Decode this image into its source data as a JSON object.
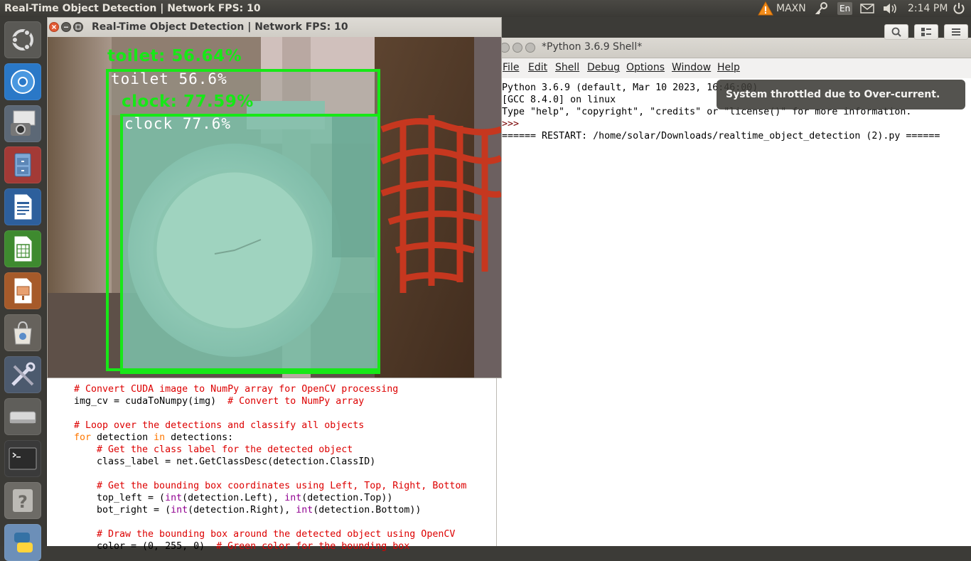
{
  "top_panel": {
    "title": "Real-Time Object Detection | Network FPS: 10",
    "power_mode": "MAXN",
    "keyboard_layout": "En",
    "clock": "2:14 PM",
    "icons": [
      "warning-icon",
      "bluetooth-key-icon",
      "mail-icon",
      "volume-icon",
      "power-icon"
    ]
  },
  "launcher": {
    "items": [
      "ubuntu-dash-icon",
      "chromium-icon",
      "screenshot-app-icon",
      "file-manager-icon",
      "writer-icon",
      "calc-icon",
      "impress-icon",
      "software-center-icon",
      "system-tools-icon",
      "drive-icon",
      "terminal-icon",
      "help-icon",
      "python-icon"
    ]
  },
  "detection_window": {
    "title": "Real-Time Object Detection | Network FPS: 10",
    "detections": [
      {
        "top_label": "toilet: 56.64%",
        "inner_label": "toilet 56.6%",
        "color": "#17e817"
      },
      {
        "top_label": "clock: 77.59%",
        "inner_label": "clock 77.6%",
        "color": "#17e817"
      }
    ]
  },
  "shell_window": {
    "title": "*Python 3.6.9 Shell*",
    "menu": [
      "File",
      "Edit",
      "Shell",
      "Debug",
      "Options",
      "Window",
      "Help"
    ],
    "lines": [
      "Python 3.6.9 (default, Mar 10 2023, 16:46:00)",
      "[GCC 8.4.0] on linux",
      "Type \"help\", \"copyright\", \"credits\" or \"license()\" for more information.",
      ">>> ",
      "====== RESTART: /home/solar/Downloads/realtime_object_detection (2).py ======"
    ]
  },
  "notification": {
    "text": "System throttled due to Over-current."
  },
  "editor": {
    "lines": [
      {
        "indent": 0,
        "parts": [
          {
            "t": "# Convert CUDA image to NumPy array for OpenCV processing",
            "c": "comment"
          }
        ]
      },
      {
        "indent": 0,
        "parts": [
          {
            "t": "img_cv = cudaToNumpy(img)  ",
            "c": "plain"
          },
          {
            "t": "# Convert to NumPy array",
            "c": "comment"
          }
        ]
      },
      {
        "indent": 0,
        "parts": []
      },
      {
        "indent": 0,
        "parts": [
          {
            "t": "# Loop over the detections and classify all objects",
            "c": "comment"
          }
        ]
      },
      {
        "indent": 0,
        "parts": [
          {
            "t": "for",
            "c": "kw"
          },
          {
            "t": " detection ",
            "c": "plain"
          },
          {
            "t": "in",
            "c": "kw"
          },
          {
            "t": " detections:",
            "c": "plain"
          }
        ]
      },
      {
        "indent": 1,
        "parts": [
          {
            "t": "# Get the class label for the detected object",
            "c": "comment"
          }
        ]
      },
      {
        "indent": 1,
        "parts": [
          {
            "t": "class_label = net.GetClassDesc(detection.ClassID)",
            "c": "plain"
          }
        ]
      },
      {
        "indent": 0,
        "parts": []
      },
      {
        "indent": 1,
        "parts": [
          {
            "t": "# Get the bounding box coordinates using Left, Top, Right, Bottom",
            "c": "comment"
          }
        ]
      },
      {
        "indent": 1,
        "parts": [
          {
            "t": "top_left = (",
            "c": "plain"
          },
          {
            "t": "int",
            "c": "builtin"
          },
          {
            "t": "(detection.Left), ",
            "c": "plain"
          },
          {
            "t": "int",
            "c": "builtin"
          },
          {
            "t": "(detection.Top))",
            "c": "plain"
          }
        ]
      },
      {
        "indent": 1,
        "parts": [
          {
            "t": "bot_right = (",
            "c": "plain"
          },
          {
            "t": "int",
            "c": "builtin"
          },
          {
            "t": "(detection.Right), ",
            "c": "plain"
          },
          {
            "t": "int",
            "c": "builtin"
          },
          {
            "t": "(detection.Bottom))",
            "c": "plain"
          }
        ]
      },
      {
        "indent": 0,
        "parts": []
      },
      {
        "indent": 1,
        "parts": [
          {
            "t": "# Draw the bounding box around the detected object using OpenCV",
            "c": "comment"
          }
        ]
      },
      {
        "indent": 1,
        "parts": [
          {
            "t": "color = (0, 255, 0)  ",
            "c": "plain"
          },
          {
            "t": "# Green color for the bounding box",
            "c": "comment"
          }
        ]
      }
    ]
  }
}
